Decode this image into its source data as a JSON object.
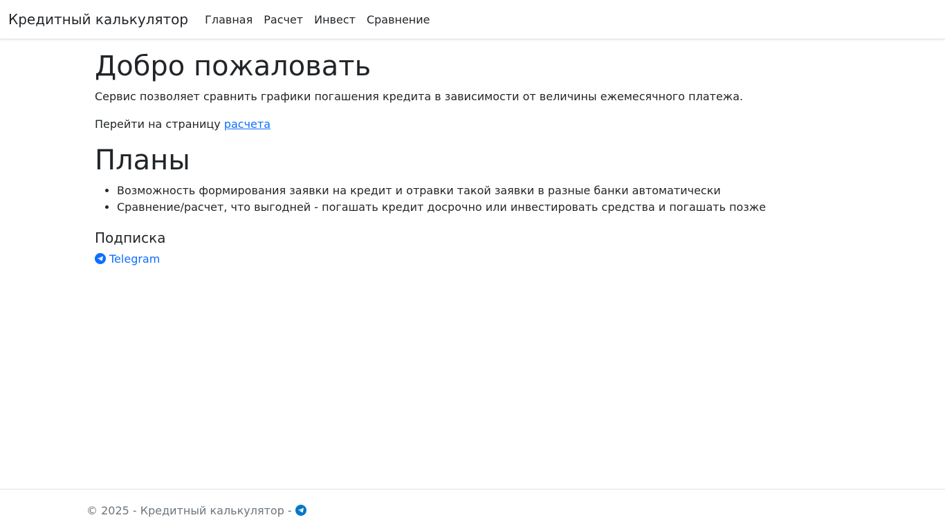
{
  "navbar": {
    "brand": "Кредитный калькулятор",
    "items": [
      {
        "label": "Главная"
      },
      {
        "label": "Расчет"
      },
      {
        "label": "Инвест"
      },
      {
        "label": "Сравнение"
      }
    ]
  },
  "main": {
    "title": "Добро пожаловать",
    "description": "Сервис позволяет сравнить графики погашения кредита в зависимости от величины ежемесячного платежа.",
    "goto_prefix": "Перейти на страницу ",
    "goto_link": "расчета",
    "plans_title": "Планы",
    "plans": [
      "Возможность формирования заявки на кредит и отравки такой заявки в разные банки автоматически",
      "Сравнение/расчет, что выгодней - погашать кредит досрочно или инвестировать средства и погашать позже"
    ],
    "subscription_title": "Подписка",
    "subscription_link": "Telegram",
    "subscription_icon": "telegram-icon"
  },
  "footer": {
    "text": "© 2025 - Кредитный калькулятор -",
    "icon": "telegram-icon"
  },
  "colors": {
    "link": "#0d6efd",
    "muted": "#6c757d",
    "text": "#212529"
  }
}
